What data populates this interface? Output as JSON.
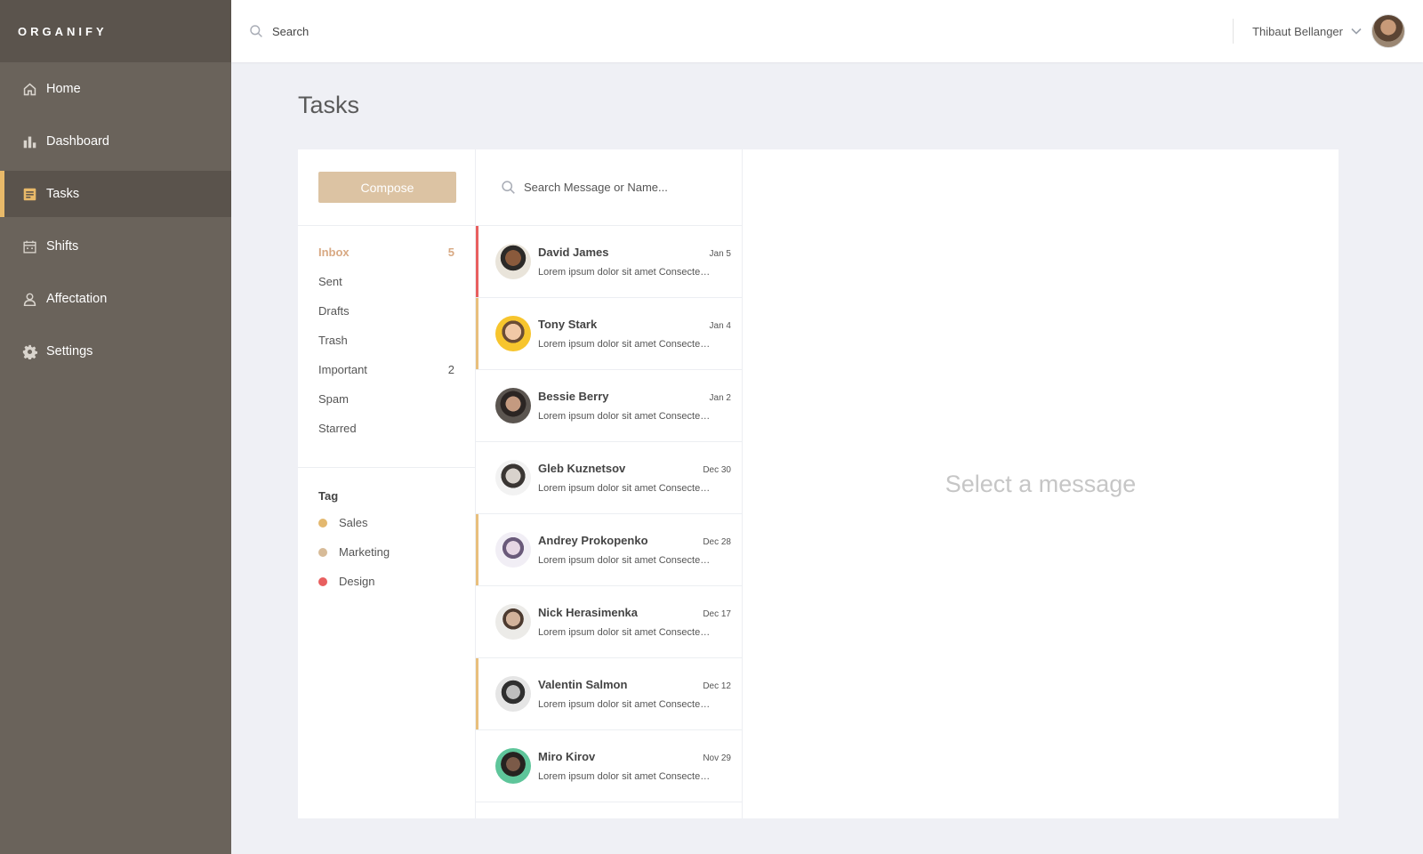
{
  "brand": "ORGANIFY",
  "nav": [
    {
      "label": "Home",
      "icon": "home-icon"
    },
    {
      "label": "Dashboard",
      "icon": "bar-chart-icon"
    },
    {
      "label": "Tasks",
      "icon": "tasks-icon",
      "active": true
    },
    {
      "label": "Shifts",
      "icon": "calendar-icon"
    },
    {
      "label": "Affectation",
      "icon": "user-icon"
    },
    {
      "label": "Settings",
      "icon": "gear-icon"
    }
  ],
  "topbar": {
    "search_placeholder": "Search",
    "user_name": "Thibaut Bellanger"
  },
  "page_title": "Tasks",
  "compose_label": "Compose",
  "folders": [
    {
      "label": "Inbox",
      "count": "5",
      "active": true
    },
    {
      "label": "Sent",
      "count": ""
    },
    {
      "label": "Drafts",
      "count": ""
    },
    {
      "label": "Trash",
      "count": ""
    },
    {
      "label": "Important",
      "count": "2"
    },
    {
      "label": "Spam",
      "count": ""
    },
    {
      "label": "Starred",
      "count": ""
    }
  ],
  "tags_title": "Tag",
  "tags": [
    {
      "label": "Sales",
      "color": "#e3b86f"
    },
    {
      "label": "Marketing",
      "color": "#d7bb98"
    },
    {
      "label": "Design",
      "color": "#e85f5f"
    }
  ],
  "list_search_placeholder": "Search Message or Name...",
  "messages": [
    {
      "name": "David James",
      "date": "Jan 5",
      "preview": "Lorem ipsum dolor sit amet Consectetur adipiscing",
      "marker": "red"
    },
    {
      "name": "Tony Stark",
      "date": "Jan 4",
      "preview": "Lorem ipsum dolor sit amet Consectetur adipiscing",
      "marker": "orange"
    },
    {
      "name": "Bessie Berry",
      "date": "Jan 2",
      "preview": "Lorem ipsum dolor sit amet Consectetur adipiscing",
      "marker": ""
    },
    {
      "name": "Gleb Kuznetsov",
      "date": "Dec 30",
      "preview": "Lorem ipsum dolor sit amet Consectetur adipiscing",
      "marker": ""
    },
    {
      "name": "Andrey Prokopenko",
      "date": "Dec 28",
      "preview": "Lorem ipsum dolor sit amet Consectetur adipiscing",
      "marker": "orange"
    },
    {
      "name": "Nick Herasimenka",
      "date": "Dec 17",
      "preview": "Lorem ipsum dolor sit amet Consectetur adipiscing",
      "marker": ""
    },
    {
      "name": "Valentin Salmon",
      "date": "Dec 12",
      "preview": "Lorem ipsum dolor sit amet Consectetur adipiscing",
      "marker": "orange"
    },
    {
      "name": "Miro Kirov",
      "date": "Nov 29",
      "preview": "Lorem ipsum dolor sit amet Consectetur adipiscing",
      "marker": ""
    }
  ],
  "empty_state": "Select a message"
}
